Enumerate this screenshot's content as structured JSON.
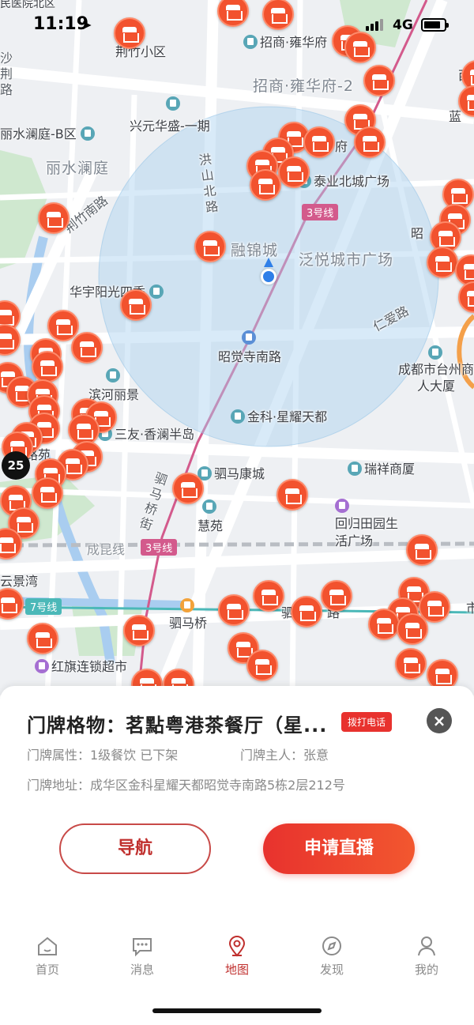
{
  "status_bar": {
    "time": "11:19",
    "network": "4G"
  },
  "map": {
    "labels": {
      "top_cut": "民医院北区",
      "jingzhu_xiaoqu": "荆竹小区",
      "shajing_lu": "沙荆路",
      "zhaoshang_1": "招商·雍华府",
      "zhaoshang_2": "招商·雍华府-2",
      "lishui_b": "丽水澜庭-B区",
      "xingyuan": "兴元华盛-一期",
      "lishui": "丽水澜庭",
      "fu": "府",
      "hongshan": "洪山北路",
      "taiye": "泰业北城广场",
      "jingzhu_nan": "荆竹南路",
      "rongjin": "融锦城",
      "fanyue": "泛悦城市广场",
      "huayu": "华宇阳光四季",
      "renai": "仁爱路",
      "zhaojue_stop": "昭觉寺南路",
      "taizhou": "成都市台州商人大厦",
      "binhe": "滨河丽景",
      "sanyou": "三友·香澜半岛",
      "jinke": "金科·星耀天都",
      "yuan": "路苑",
      "sima_jie": "驷马桥街",
      "simakang": "驷马康城",
      "ruixiang": "瑞祥商厦",
      "huiyuan": "慧苑",
      "huigui": "回归田园生活广场",
      "chengkun": "成昆线",
      "yunjing": "云景湾",
      "simaqiao": "驷马桥",
      "hongqi": "红旗连锁超市",
      "si": "驷",
      "lu_r": "路",
      "zhao_r": "昭",
      "xi_r": "西",
      "lan_r": "蓝",
      "shi_r": "市"
    },
    "metro": {
      "line3_a": "3号线",
      "line3_b": "3号线",
      "line7": "7号线"
    },
    "cluster_count": "25"
  },
  "sheet": {
    "title": "门牌格物：茗點粤港茶餐厅（星...",
    "call_label": "拨打电话",
    "attr_label": "门牌属性：1级餐饮 已下架",
    "owner_label": "门牌主人：张意",
    "address_label": "门牌地址：成华区金科星耀天都昭觉寺南路5栋2层212号",
    "nav_button": "导航",
    "live_button": "申请直播"
  },
  "tabs": [
    {
      "label": "首页",
      "icon": "home-icon"
    },
    {
      "label": "消息",
      "icon": "message-icon"
    },
    {
      "label": "地图",
      "icon": "map-pin-icon"
    },
    {
      "label": "发现",
      "icon": "compass-icon"
    },
    {
      "label": "我的",
      "icon": "user-icon"
    }
  ],
  "colors": {
    "accent": "#e8322e",
    "marker": "#f2522e",
    "metro_line3": "#d35a8c",
    "metro_line7": "#4bb8b8"
  }
}
